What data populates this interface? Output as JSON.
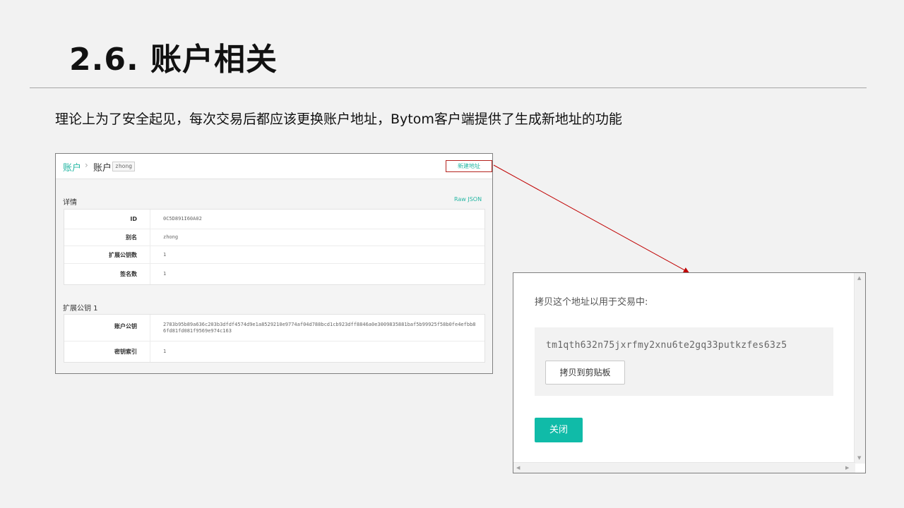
{
  "slide": {
    "title": "2.6. 账户相关",
    "subtitle": "理论上为了安全起见，每次交易后都应该更换账户地址，Bytom客户端提供了生成新地址的功能"
  },
  "account_page": {
    "breadcrumb_root": "账户",
    "breadcrumb_sep": "›",
    "breadcrumb_current": "账户",
    "account_tag": "zhong",
    "new_address_button": "新建地址",
    "details_heading": "详情",
    "raw_json_link": "Raw JSON",
    "details": [
      {
        "key": "ID",
        "value": "0C5D891I60A02"
      },
      {
        "key": "别名",
        "value": "zhong"
      },
      {
        "key": "扩展公钥数",
        "value": "1"
      },
      {
        "key": "签名数",
        "value": "1"
      }
    ],
    "xpub_heading": "扩展公钥 1",
    "xpub": [
      {
        "key": "账户公钥",
        "value": "2783b95b89a636c203b3dfdf4574d9e1a8529210e9774af04d788bcd1cb923dff8846a0e3009835881baf5b99925f58b0fe4efbb86fd81fd081f9569e974c163"
      },
      {
        "key": "密钥索引",
        "value": "1"
      }
    ]
  },
  "modal": {
    "prompt": "拷贝这个地址以用于交易中:",
    "address": "tm1qth632n75jxrfmy2xnu6te2gq33putkzfes63z5",
    "copy_button": "拷贝到剪贴板",
    "close_button": "关闭"
  },
  "colors": {
    "accent": "#10bba8",
    "link": "#26b7a4",
    "highlight_border": "#b5231e",
    "connector": "#c00000"
  }
}
